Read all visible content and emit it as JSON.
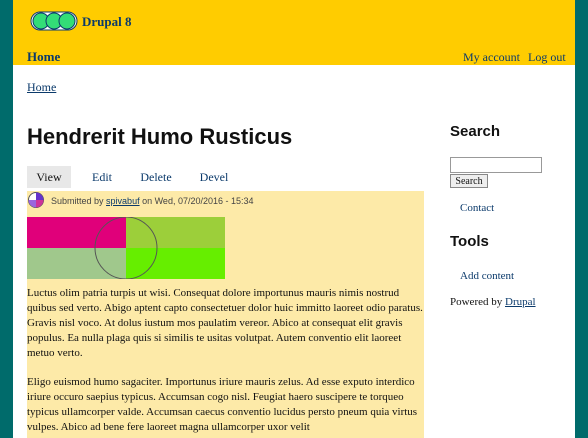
{
  "header": {
    "site_name": "Drupal 8",
    "nav": {
      "home": "Home"
    },
    "user_menu": {
      "my_account": "My account",
      "logout": "Log out"
    }
  },
  "breadcrumb": {
    "home": "Home"
  },
  "node": {
    "title": "Hendrerit Humo Rusticus",
    "tabs": [
      "View",
      "Edit",
      "Delete",
      "Devel"
    ],
    "active_tab": "View",
    "submitted": {
      "prefix": "Submitted by",
      "author": "spivabuf",
      "suffix": "on Wed, 07/20/2016 - 15:34"
    },
    "image_colors": [
      "#e0007a",
      "#9ccf3a",
      "#a0c88c",
      "#66ee00"
    ],
    "paragraphs": [
      "Luctus olim patria turpis ut wisi. Consequat dolore importunus mauris nimis nostrud quibus sed verto. Abigo aptent capto consectetuer dolor huic immitto laoreet odio paratus. Gravis nisl voco. At dolus iustum mos paulatim vereor. Abico at consequat elit gravis populus. Ea nulla plaga quis si similis te usitas volutpat. Autem conventio elit laoreet metuo verto.",
      "Eligo euismod humo sagaciter. Importunus iriure mauris zelus. Ad esse exputo interdico iriure occuro saepius typicus. Accumsan cogo nisl. Feugiat haero suscipere te torqueo typicus ullamcorper valde. Accumsan caecus conventio lucidus persto pneum quia virtus vulpes. Abico ad bene fere laoreet magna ullamcorper uxor velit"
    ]
  },
  "sidebar": {
    "search": {
      "title": "Search",
      "button": "Search",
      "value": ""
    },
    "menu": {
      "contact": "Contact"
    },
    "tools": {
      "title": "Tools",
      "add_content": "Add content"
    },
    "powered_by": {
      "prefix": "Powered by",
      "link": "Drupal"
    }
  },
  "colors": {
    "background": "#006b6b",
    "header": "#ffcc00",
    "node_background": "#fdeaa8",
    "link": "#0b3a6b"
  }
}
